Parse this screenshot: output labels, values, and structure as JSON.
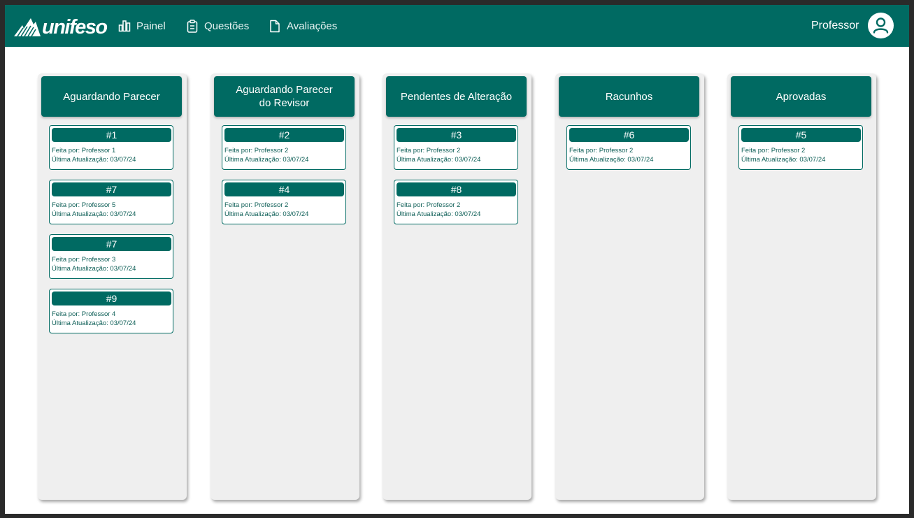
{
  "app": {
    "logo_text": "unifeso",
    "nav": [
      {
        "label": "Painel",
        "icon": "bar-chart-icon"
      },
      {
        "label": "Questões",
        "icon": "clipboard-icon"
      },
      {
        "label": "Avaliações",
        "icon": "document-icon"
      }
    ],
    "user": {
      "name": "Professor",
      "icon": "user-icon"
    }
  },
  "colors": {
    "primary": "#006a62",
    "column_bg": "#efefef",
    "page_bg": "#ffffff"
  },
  "columns": [
    {
      "title": "Aguardando Parecer",
      "cards": [
        {
          "id": "#1",
          "author": "Feita por: Professor 1",
          "updated": "Última Atualização: 03/07/24"
        },
        {
          "id": "#7",
          "author": "Feita por: Professor 5",
          "updated": "Última Atualização: 03/07/24"
        },
        {
          "id": "#7",
          "author": "Feita por: Professor 3",
          "updated": "Última Atualização: 03/07/24"
        },
        {
          "id": "#9",
          "author": "Feita por: Professor 4",
          "updated": "Última Atualização: 03/07/24"
        }
      ]
    },
    {
      "title": "Aguardando Parecer\ndo Revisor",
      "cards": [
        {
          "id": "#2",
          "author": "Feita por: Professor 2",
          "updated": "Última Atualização: 03/07/24"
        },
        {
          "id": "#4",
          "author": "Feita por: Professor 2",
          "updated": "Última Atualização: 03/07/24"
        }
      ]
    },
    {
      "title": "Pendentes de Alteração",
      "cards": [
        {
          "id": "#3",
          "author": "Feita por: Professor 2",
          "updated": "Última Atualização: 03/07/24"
        },
        {
          "id": "#8",
          "author": "Feita por: Professor 2",
          "updated": "Última Atualização: 03/07/24"
        }
      ]
    },
    {
      "title": "Racunhos",
      "cards": [
        {
          "id": "#6",
          "author": "Feita por: Professor 2",
          "updated": "Última Atualização: 03/07/24"
        }
      ]
    },
    {
      "title": "Aprovadas",
      "cards": [
        {
          "id": "#5",
          "author": "Feita por: Professor 2",
          "updated": "Última Atualização: 03/07/24"
        }
      ]
    }
  ]
}
